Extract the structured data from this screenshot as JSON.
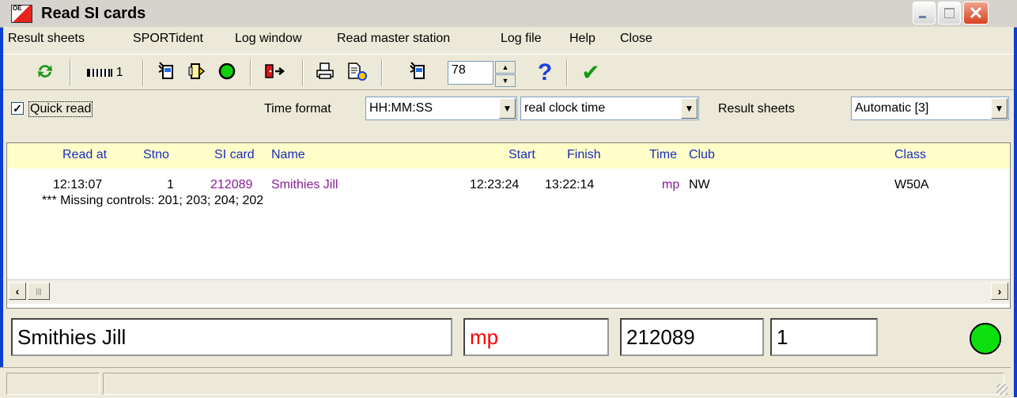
{
  "window": {
    "title": "Read SI cards",
    "logo_text": "OE",
    "close_glyph": "✕"
  },
  "menu": [
    {
      "label": "Result sheets"
    },
    {
      "label": "SPORTident"
    },
    {
      "label": "Log window"
    },
    {
      "label": "Read master station"
    },
    {
      "label": "Log file"
    },
    {
      "label": "Help"
    },
    {
      "label": "Close"
    }
  ],
  "toolbar": {
    "refresh_icon": "refresh-icon",
    "station_label": "1",
    "spinner_value": "78",
    "help_glyph": "?",
    "ok_glyph": "✔"
  },
  "options": {
    "quick_read_label": "Quick read",
    "quick_read_checked": true,
    "time_format_label": "Time format",
    "time_format_value": "HH:MM:SS",
    "clock_mode_value": "real clock time",
    "result_sheets_label": "Result sheets",
    "result_sheets_value": "Automatic [3]"
  },
  "table": {
    "headers": [
      "Read at",
      "Stno",
      "SI card",
      "Name",
      "Start",
      "Finish",
      "Time",
      "Club",
      "Class"
    ],
    "rows": [
      {
        "read_at": "12:13:07",
        "stno": "1",
        "si_card": "212089",
        "name": "Smithies Jill",
        "start": "12:23:24",
        "finish": "13:22:14",
        "time": "mp",
        "club": "NW",
        "class": "W50A",
        "note": "*** Missing controls: 201; 203; 204; 202"
      }
    ]
  },
  "summary": {
    "name": "Smithies Jill",
    "status": "mp",
    "si_card": "212089",
    "stno": "1"
  },
  "colors": {
    "header_text": "#1a2cc0",
    "highlight_text": "#8a1a9a",
    "status_red": "#ff0000",
    "led_green": "#0ce00c"
  }
}
